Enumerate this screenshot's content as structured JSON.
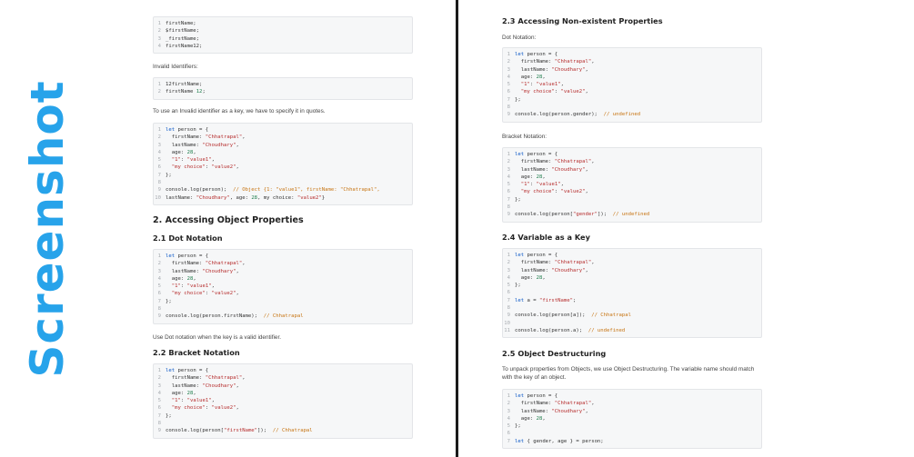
{
  "side_label": "Screenshot",
  "left": {
    "code_identifiers": [
      "firstName;",
      "$firstName;",
      "_firstName;",
      "firstName12;"
    ],
    "invalid_identifiers_text": "Invalid Identifiers:",
    "code_invalid": [
      "12firstName;",
      "firstName 12;"
    ],
    "quotes_text": "To use an Invalid identifier as a key, we have to specify it in quotes.",
    "code_person_log": [
      "let person = {",
      "  firstName: \"Chhatrapal\",",
      "  lastName: \"Choudhary\",",
      "  age: 28,",
      "  \"1\": \"value1\",",
      "  \"my choice\": \"value2\",",
      "};",
      "",
      "console.log(person);  // Object {1: \"value1\", firstName: \"Chhatrapal\",",
      "lastName: \"Choudhary\", age: 28, my choice: \"value2\"}"
    ],
    "heading_access": "2. Accessing Object Properties",
    "heading_dot": "2.1 Dot Notation",
    "code_dot": [
      "let person = {",
      "  firstName: \"Chhatrapal\",",
      "  lastName: \"Choudhary\",",
      "  age: 28,",
      "  \"1\": \"value1\",",
      "  \"my choice\": \"value2\",",
      "};",
      "",
      "console.log(person.firstName);  // Chhatrapal"
    ],
    "dot_note": "Use Dot notation when the key is a valid identifier.",
    "heading_bracket": "2.2 Bracket Notation",
    "code_bracket": [
      "let person = {",
      "  firstName: \"Chhatrapal\",",
      "  lastName: \"Choudhary\",",
      "  age: 28,",
      "  \"1\": \"value1\",",
      "  \"my choice\": \"value2\",",
      "};",
      "",
      "console.log(person[\"firstName\"]);  // Chhatrapal"
    ]
  },
  "right": {
    "heading_nonexistent": "2.3 Accessing Non-existent Properties",
    "dot_label": "Dot Notation:",
    "code_nonexistent_dot": [
      "let person = {",
      "  firstName: \"Chhatrapal\",",
      "  lastName: \"Choudhary\",",
      "  age: 28,",
      "  \"1\": \"value1\",",
      "  \"my choice\": \"value2\",",
      "};",
      "",
      "console.log(person.gender);  // undefined"
    ],
    "bracket_label": "Bracket Notation:",
    "code_nonexistent_bracket": [
      "let person = {",
      "  firstName: \"Chhatrapal\",",
      "  lastName: \"Choudhary\",",
      "  age: 28,",
      "  \"1\": \"value1\",",
      "  \"my choice\": \"value2\",",
      "};",
      "",
      "console.log(person[\"gender\"]);  // undefined"
    ],
    "heading_variable_key": "2.4 Variable as a Key",
    "code_variable_key": [
      "let person = {",
      "  firstName: \"Chhatrapal\",",
      "  lastName: \"Choudhary\",",
      "  age: 28,",
      "};",
      "",
      "let a = \"firstName\";",
      "",
      "console.log(person[a]);  // Chhatrapal",
      "",
      "console.log(person.a);  // undefined"
    ],
    "heading_destructuring": "2.5 Object Destructuring",
    "destructuring_text": "To unpack properties from Objects, we use Object Destructuring. The variable name should match with the key of an object.",
    "code_destructuring": [
      "let person = {",
      "  firstName: \"Chhatrapal\",",
      "  lastName: \"Choudhary\",",
      "  age: 28,",
      "};",
      "",
      "let { gender, age } = person;"
    ]
  }
}
